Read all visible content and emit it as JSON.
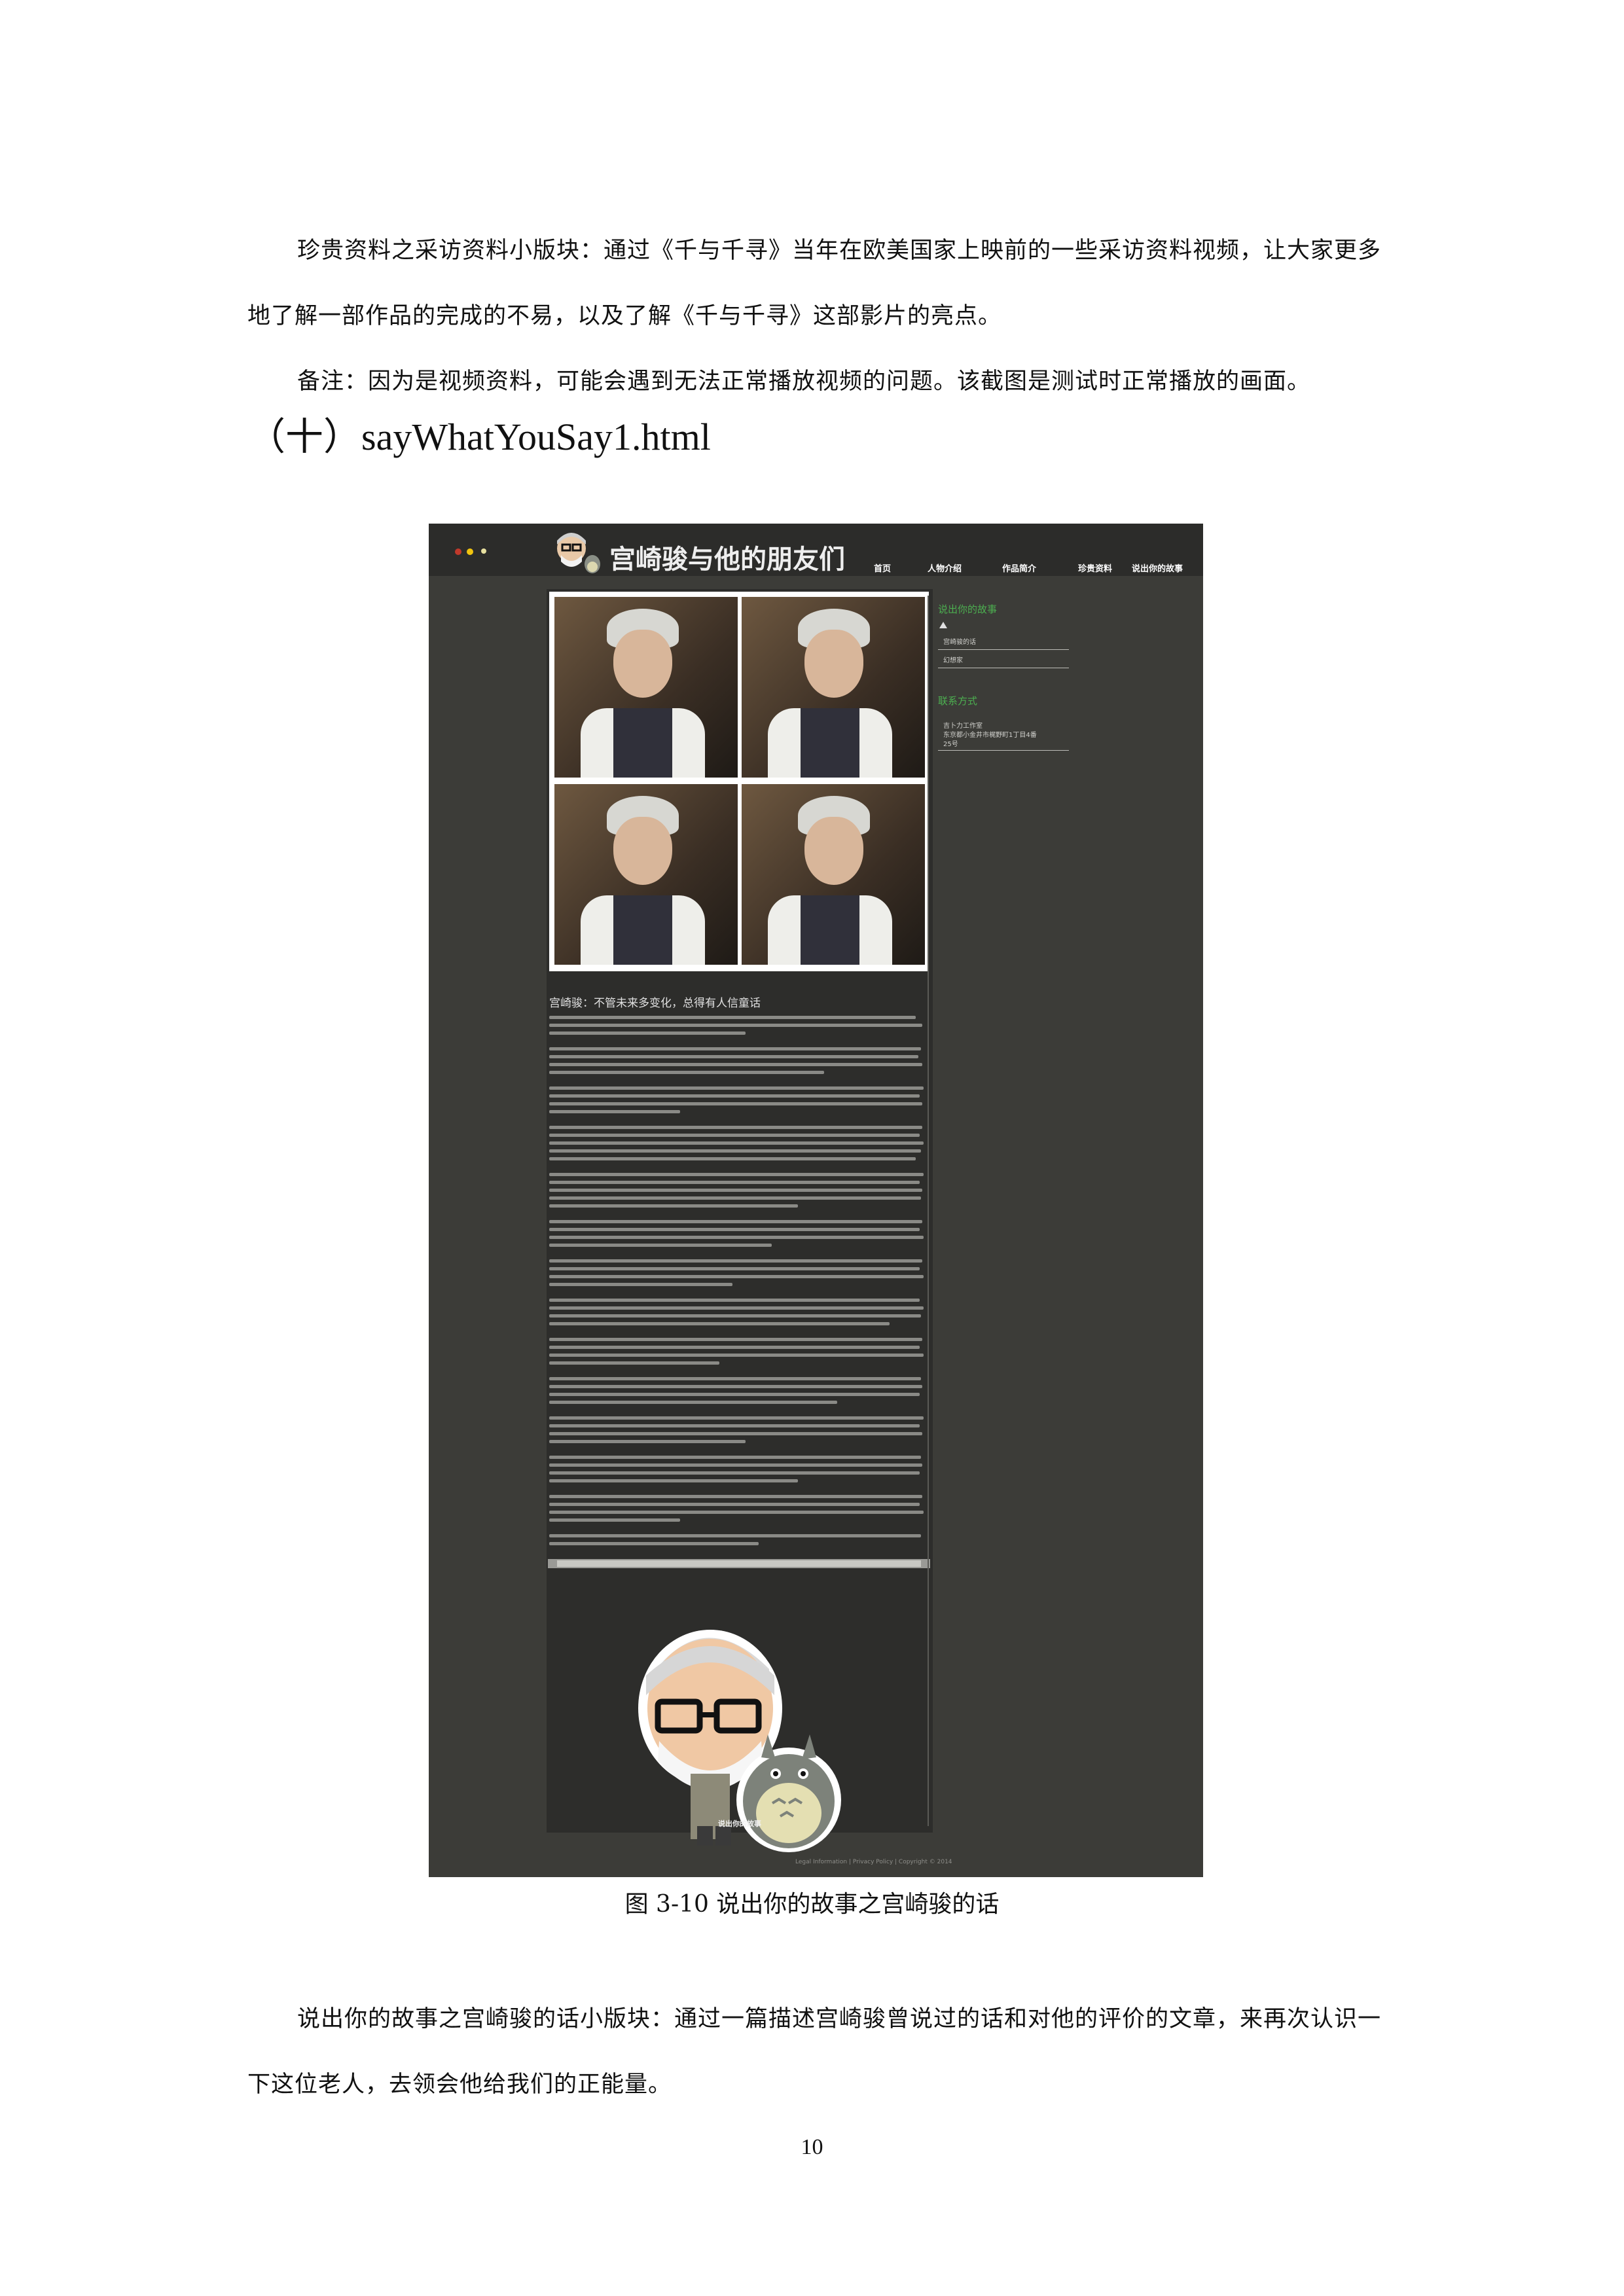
{
  "page": {
    "paragraph1": "珍贵资料之采访资料小版块：通过《千与千寻》当年在欧美国家上映前的一些采访资料视频，让大家更多地了解一部作品的完成的不易，以及了解《千与千寻》这部影片的亮点。",
    "paragraph2": "备注：因为是视频资料，可能会遇到无法正常播放视频的问题。该截图是测试时正常播放的画面。",
    "heading": "（十）sayWhatYouSay1.html",
    "caption": "图 3-10 说出你的故事之宫崎骏的话",
    "paragraph3": "说出你的故事之宫崎骏的话小版块：通过一篇描述宫崎骏曾说过的话和对他的评价的文章，来再次认识一下这位老人，去领会他给我们的正能量。",
    "page_number": "10"
  },
  "screenshot": {
    "logo_text": "宫崎骏与他的朋友们",
    "nav": [
      "首页",
      "人物介绍",
      "作品简介",
      "珍贵资料",
      "说出你的故事"
    ],
    "article_title": "宫崎骏：不管未来多变化，总得有人信童话",
    "footer_link": "说出你的故事",
    "copyright": "Legal Information | Privacy Policy | Copyright © 2014",
    "sidebar": {
      "section1_title": "说出你的故事",
      "section1_items": [
        "宫崎骏的话",
        "幻想家"
      ],
      "section2_title": "联系方式",
      "contact_lines": [
        "吉卜力工作室",
        "东京都小金井市梶野町1丁目4番",
        "25号"
      ]
    },
    "colors": {
      "background": "#3c3c38",
      "accent_green": "#4caf50"
    }
  }
}
